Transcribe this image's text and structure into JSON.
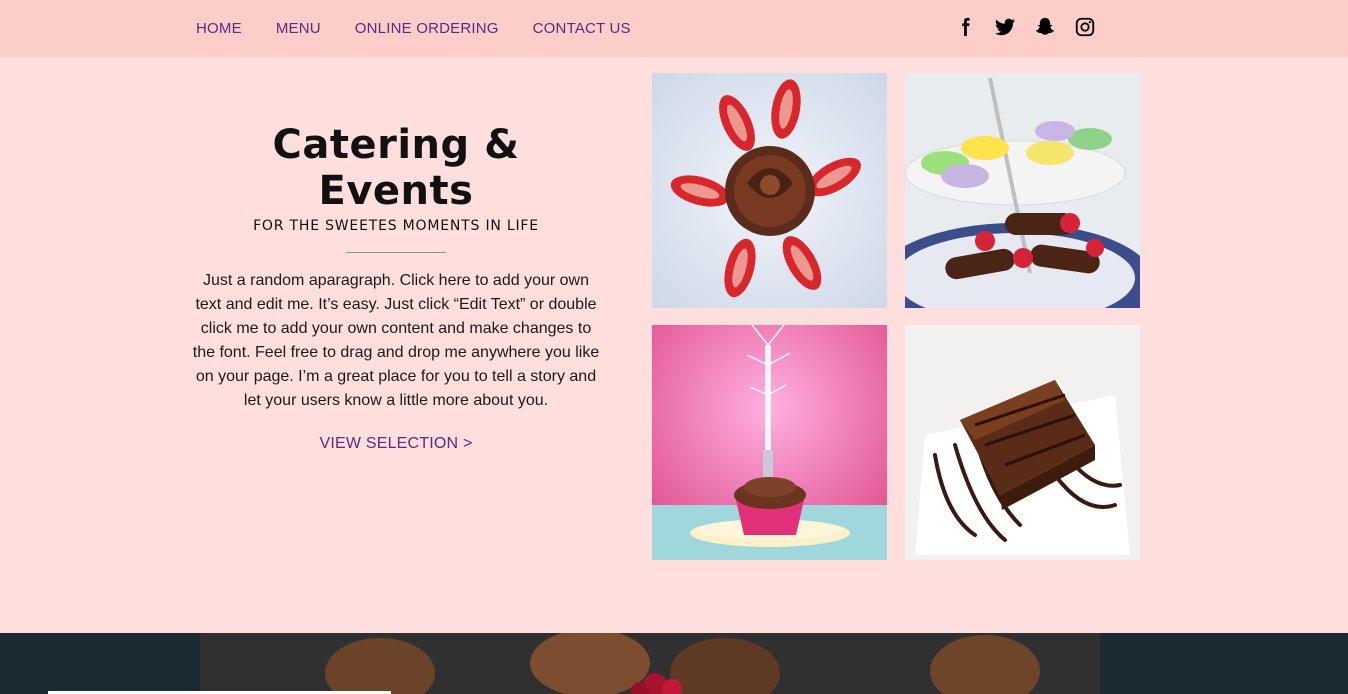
{
  "nav": {
    "items": [
      "HOME",
      "MENU",
      "ONLINE ORDERING",
      "CONTACT US"
    ]
  },
  "social": {
    "icons": [
      "facebook-icon",
      "twitter-icon",
      "snapchat-icon",
      "instagram-icon"
    ]
  },
  "hero": {
    "title": "Catering & Events",
    "subtitle": "FOR THE SWEETES MOMENTS IN LIFE",
    "paragraph": "Just a random aparagraph. Click here to add your own text and edit me. It’s easy. Just click “Edit Text” or double click me to add your own content and make changes to the font. Feel free to drag and drop me anywhere you like on your page. I’m a great place for you to tell a story and let your users know a little more about you.",
    "cta": "VIEW SELECTION >"
  },
  "gallery": {
    "images": [
      "cupcake-strawberries-photo",
      "macarons-eclairs-photo",
      "sparkler-cupcake-photo",
      "chocolate-brownie-photo"
    ]
  },
  "colors": {
    "header_bg": "#fccdc9",
    "page_bg": "#ffdede",
    "nav_text": "#5d2a7d",
    "divider": "#7b9b84"
  }
}
